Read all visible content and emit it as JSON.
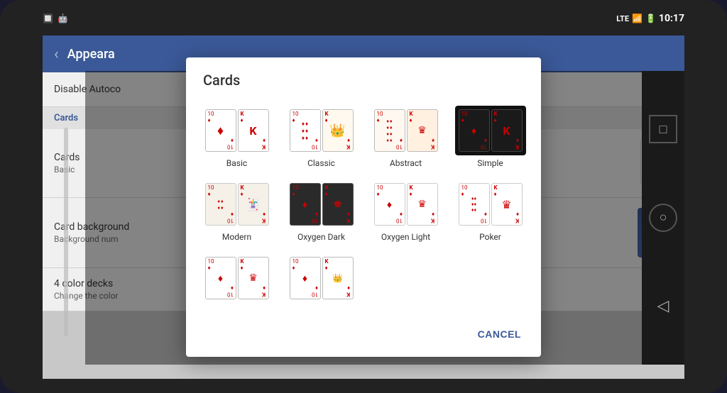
{
  "statusBar": {
    "time": "10:17",
    "icons": [
      "lte-icon",
      "signal-icon",
      "battery-icon"
    ]
  },
  "appBar": {
    "backLabel": "‹",
    "title": "Appeara"
  },
  "settingsSections": [
    {
      "type": "item",
      "label": "Disable Autoco",
      "hasCheckbox": true,
      "id": "disable-auto"
    },
    {
      "type": "header",
      "label": "Cards"
    },
    {
      "type": "item",
      "label": "Cards",
      "sublabel": "Basic",
      "hasThumb": false,
      "hasKingThumb": true,
      "id": "cards-item"
    },
    {
      "type": "item",
      "label": "Card background",
      "sublabel": "Background num",
      "hasThumb": true,
      "id": "card-bg-item"
    },
    {
      "type": "item",
      "label": "4 color decks",
      "sublabel": "Change the color",
      "hasCheckbox": true,
      "id": "four-color-item"
    }
  ],
  "dialog": {
    "title": "Cards",
    "cancelLabel": "CANCEL",
    "options": [
      {
        "id": "basic",
        "label": "Basic",
        "selected": false
      },
      {
        "id": "classic",
        "label": "Classic",
        "selected": false
      },
      {
        "id": "abstract",
        "label": "Abstract",
        "selected": false
      },
      {
        "id": "simple",
        "label": "Simple",
        "selected": true
      },
      {
        "id": "modern",
        "label": "Modern",
        "selected": false
      },
      {
        "id": "oxygen-dark",
        "label": "Oxygen Dark",
        "selected": false
      },
      {
        "id": "oxygen-light",
        "label": "Oxygen Light",
        "selected": false
      },
      {
        "id": "poker",
        "label": "Poker",
        "selected": false
      },
      {
        "id": "row2col1",
        "label": "",
        "selected": false
      },
      {
        "id": "row2col2",
        "label": "",
        "selected": false
      }
    ]
  },
  "navButtons": {
    "squareLabel": "□",
    "circleLabel": "○",
    "backLabel": "◁"
  },
  "sidebar": {
    "scrollIndicator": "│"
  }
}
